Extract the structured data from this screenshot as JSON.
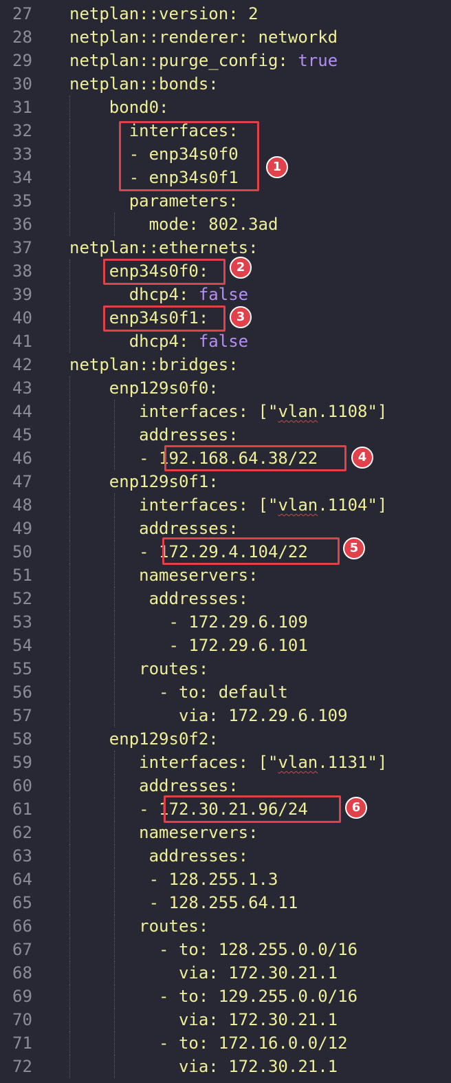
{
  "editor": {
    "theme_colors": {
      "background": "#272833",
      "line_number": "#8c8d98",
      "key_text": "#f0ef9a",
      "boolean_value": "#b48ef5",
      "highlight_box": "#e0414b"
    },
    "lines": [
      {
        "num": "27",
        "segments": [
          {
            "t": "netplan::version: 2",
            "c": "k"
          }
        ]
      },
      {
        "num": "28",
        "segments": [
          {
            "t": "netplan::renderer: networkd",
            "c": "k"
          }
        ]
      },
      {
        "num": "29",
        "segments": [
          {
            "t": "netplan::purge_config: ",
            "c": "k"
          },
          {
            "t": "true",
            "c": "p"
          }
        ]
      },
      {
        "num": "30",
        "segments": [
          {
            "t": "netplan::bonds:",
            "c": "k"
          }
        ]
      },
      {
        "num": "31",
        "segments": [
          {
            "t": "    bond0:",
            "c": "k"
          }
        ]
      },
      {
        "num": "32",
        "segments": [
          {
            "t": "      interfaces:",
            "c": "k"
          }
        ]
      },
      {
        "num": "33",
        "segments": [
          {
            "t": "      - enp34s0f0",
            "c": "k"
          }
        ]
      },
      {
        "num": "34",
        "segments": [
          {
            "t": "      - enp34s0f1",
            "c": "k"
          }
        ]
      },
      {
        "num": "35",
        "segments": [
          {
            "t": "      parameters:",
            "c": "k"
          }
        ]
      },
      {
        "num": "36",
        "segments": [
          {
            "t": "        mode: 802.3ad",
            "c": "k"
          }
        ]
      },
      {
        "num": "37",
        "segments": [
          {
            "t": "netplan::ethernets:",
            "c": "k"
          }
        ]
      },
      {
        "num": "38",
        "segments": [
          {
            "t": "    enp34s0f0:",
            "c": "k"
          }
        ]
      },
      {
        "num": "39",
        "segments": [
          {
            "t": "      dhcp4: ",
            "c": "k"
          },
          {
            "t": "false",
            "c": "p"
          }
        ]
      },
      {
        "num": "40",
        "segments": [
          {
            "t": "    enp34s0f1:",
            "c": "k"
          }
        ]
      },
      {
        "num": "41",
        "segments": [
          {
            "t": "      dhcp4: ",
            "c": "k"
          },
          {
            "t": "false",
            "c": "p"
          }
        ]
      },
      {
        "num": "42",
        "segments": [
          {
            "t": "netplan::bridges:",
            "c": "k"
          }
        ]
      },
      {
        "num": "43",
        "segments": [
          {
            "t": "    enp129s0f0:",
            "c": "k"
          }
        ]
      },
      {
        "num": "44",
        "segments": [
          {
            "t": "       interfaces: [\"",
            "c": "k"
          },
          {
            "t": "vlan",
            "c": "k",
            "sq": true
          },
          {
            "t": ".1108\"]",
            "c": "k"
          }
        ]
      },
      {
        "num": "45",
        "segments": [
          {
            "t": "       addresses:",
            "c": "k"
          }
        ]
      },
      {
        "num": "46",
        "segments": [
          {
            "t": "       - 192.168.64.38/22",
            "c": "k"
          }
        ]
      },
      {
        "num": "47",
        "segments": [
          {
            "t": "    enp129s0f1:",
            "c": "k"
          }
        ]
      },
      {
        "num": "48",
        "segments": [
          {
            "t": "       interfaces: [\"",
            "c": "k"
          },
          {
            "t": "vlan",
            "c": "k",
            "sq": true
          },
          {
            "t": ".1104\"]",
            "c": "k"
          }
        ]
      },
      {
        "num": "49",
        "segments": [
          {
            "t": "       addresses:",
            "c": "k"
          }
        ]
      },
      {
        "num": "50",
        "segments": [
          {
            "t": "       - 172.29.4.104/22",
            "c": "k"
          }
        ]
      },
      {
        "num": "51",
        "segments": [
          {
            "t": "       nameservers:",
            "c": "k"
          }
        ]
      },
      {
        "num": "52",
        "segments": [
          {
            "t": "        addresses:",
            "c": "k"
          }
        ]
      },
      {
        "num": "53",
        "segments": [
          {
            "t": "          - 172.29.6.109",
            "c": "k"
          }
        ]
      },
      {
        "num": "54",
        "segments": [
          {
            "t": "          - 172.29.6.101",
            "c": "k"
          }
        ]
      },
      {
        "num": "55",
        "segments": [
          {
            "t": "       routes:",
            "c": "k"
          }
        ]
      },
      {
        "num": "56",
        "segments": [
          {
            "t": "         - to: default",
            "c": "k"
          }
        ]
      },
      {
        "num": "57",
        "segments": [
          {
            "t": "           via: 172.29.6.109",
            "c": "k"
          }
        ]
      },
      {
        "num": "58",
        "segments": [
          {
            "t": "    enp129s0f2:",
            "c": "k"
          }
        ]
      },
      {
        "num": "59",
        "segments": [
          {
            "t": "       interfaces: [\"",
            "c": "k"
          },
          {
            "t": "vlan",
            "c": "k",
            "sq": true
          },
          {
            "t": ".1131\"]",
            "c": "k"
          }
        ]
      },
      {
        "num": "60",
        "segments": [
          {
            "t": "       addresses:",
            "c": "k"
          }
        ]
      },
      {
        "num": "61",
        "segments": [
          {
            "t": "       - 172.30.21.96/24",
            "c": "k"
          }
        ]
      },
      {
        "num": "62",
        "segments": [
          {
            "t": "       nameservers:",
            "c": "k"
          }
        ]
      },
      {
        "num": "63",
        "segments": [
          {
            "t": "        addresses:",
            "c": "k"
          }
        ]
      },
      {
        "num": "64",
        "segments": [
          {
            "t": "        - 128.255.1.3",
            "c": "k"
          }
        ]
      },
      {
        "num": "65",
        "segments": [
          {
            "t": "        - 128.255.64.11",
            "c": "k"
          }
        ]
      },
      {
        "num": "66",
        "segments": [
          {
            "t": "       routes:",
            "c": "k"
          }
        ]
      },
      {
        "num": "67",
        "segments": [
          {
            "t": "         - to: 128.255.0.0/16",
            "c": "k"
          }
        ]
      },
      {
        "num": "68",
        "segments": [
          {
            "t": "           via: 172.30.21.1",
            "c": "k"
          }
        ]
      },
      {
        "num": "69",
        "segments": [
          {
            "t": "         - to: 129.255.0.0/16",
            "c": "k"
          }
        ]
      },
      {
        "num": "70",
        "segments": [
          {
            "t": "           via: 172.30.21.1",
            "c": "k"
          }
        ]
      },
      {
        "num": "71",
        "segments": [
          {
            "t": "         - to: 172.16.0.0/12",
            "c": "k"
          }
        ]
      },
      {
        "num": "72",
        "segments": [
          {
            "t": "           via: 172.30.21.1",
            "c": "k"
          }
        ]
      }
    ]
  },
  "annotations": [
    {
      "label": "1",
      "target_line": "33-34"
    },
    {
      "label": "2",
      "target_line": "38"
    },
    {
      "label": "3",
      "target_line": "40"
    },
    {
      "label": "4",
      "target_line": "46"
    },
    {
      "label": "5",
      "target_line": "50"
    },
    {
      "label": "6",
      "target_line": "61"
    }
  ]
}
